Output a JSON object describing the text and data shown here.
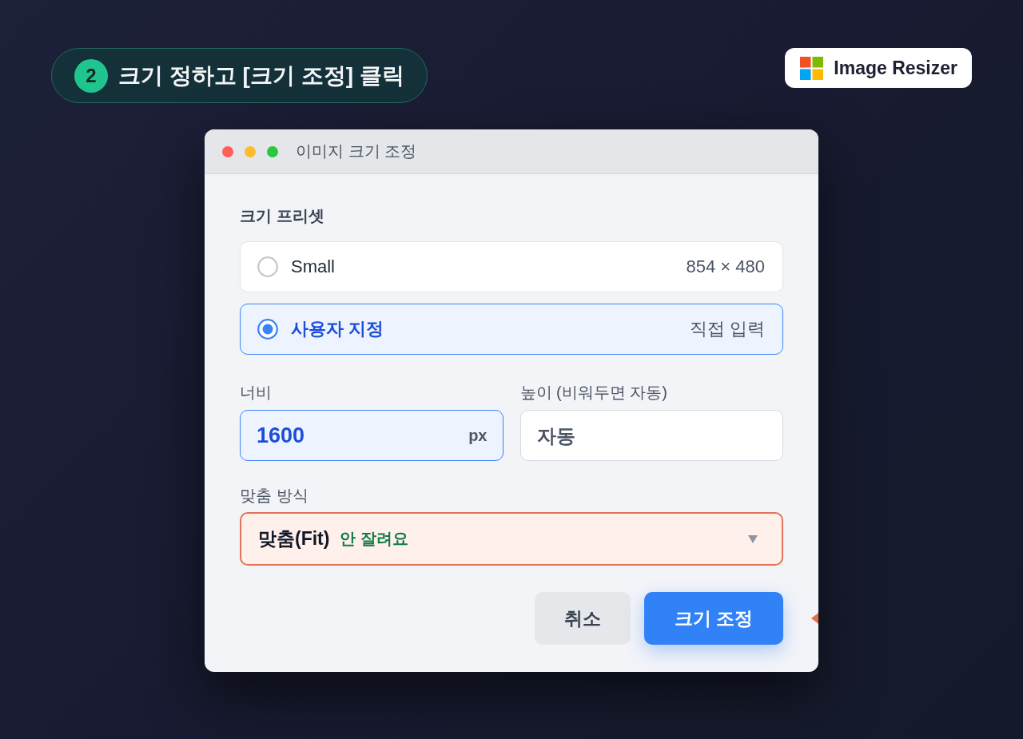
{
  "step_banner": {
    "number": "2",
    "text": "크기 정하고 [크기 조정] 클릭"
  },
  "brand": {
    "name": "Image Resizer"
  },
  "window": {
    "title": "이미지 크기 조정"
  },
  "presets": {
    "label": "크기 프리셋",
    "options": [
      {
        "name": "Small",
        "detail": "854 × 480",
        "selected": false
      },
      {
        "name": "사용자 지정",
        "detail": "직접 입력",
        "selected": true
      }
    ]
  },
  "fields": [
    {
      "label": "너비",
      "value": "1600",
      "unit": "px",
      "focused": true
    },
    {
      "label": "높이 (비워두면 자동)",
      "placeholder": "자동",
      "focused": false
    }
  ],
  "fit_mode": {
    "label": "맞춤 방식",
    "value": "맞춤(Fit)",
    "note": "안 잘려요",
    "highlighted": true
  },
  "buttons": [
    {
      "label": "취소",
      "kind": "secondary"
    },
    {
      "label": "크기 조정",
      "kind": "primary"
    }
  ]
}
